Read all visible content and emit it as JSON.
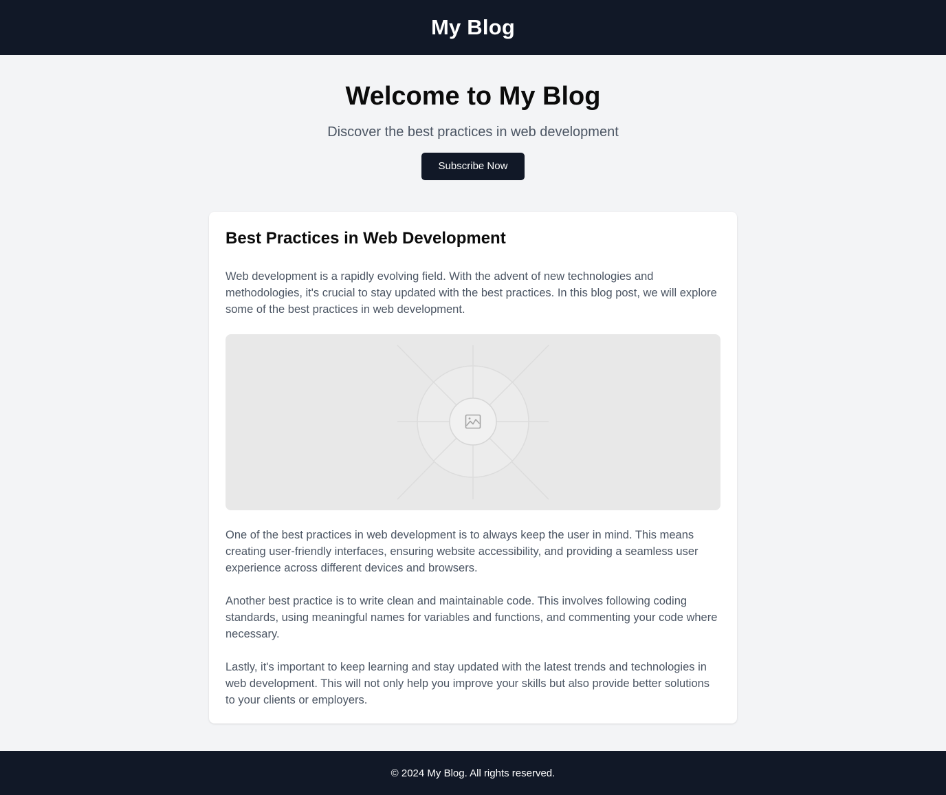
{
  "header": {
    "site_title": "My Blog"
  },
  "hero": {
    "title": "Welcome to My Blog",
    "subtitle": "Discover the best practices in web development",
    "cta_label": "Subscribe Now"
  },
  "article": {
    "title": "Best Practices in Web Development",
    "intro": "Web development is a rapidly evolving field. With the advent of new technologies and methodologies, it's crucial to stay updated with the best practices. In this blog post, we will explore some of the best practices in web development.",
    "image_icon": "image-icon",
    "paragraphs": [
      "One of the best practices in web development is to always keep the user in mind. This means creating user-friendly interfaces, ensuring website accessibility, and providing a seamless user experience across different devices and browsers.",
      "Another best practice is to write clean and maintainable code. This involves following coding standards, using meaningful names for variables and functions, and commenting your code where necessary.",
      "Lastly, it's important to keep learning and stay updated with the latest trends and technologies in web development. This will not only help you improve your skills but also provide better solutions to your clients or employers."
    ]
  },
  "footer": {
    "copyright": "© 2024 My Blog. All rights reserved."
  },
  "colors": {
    "dark": "#111827",
    "page_bg": "#f3f4f6",
    "body_text": "#4b5563",
    "card_bg": "#ffffff",
    "placeholder_bg": "#e8e8e8"
  }
}
